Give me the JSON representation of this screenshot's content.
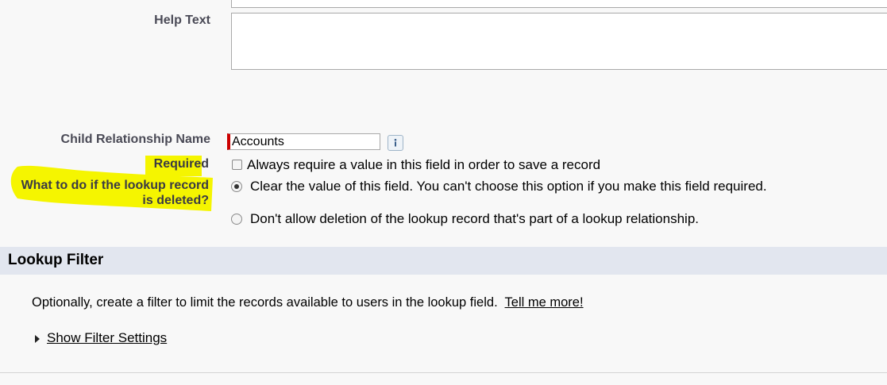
{
  "form": {
    "help_text_label": "Help Text",
    "help_text_value": "",
    "child_rel_label": "Child Relationship Name",
    "child_rel_value": "Accounts",
    "required_label": "Required",
    "required_checkbox_text": "Always require a value in this field in order to save a record",
    "required_checked": false,
    "delete_label_line1": "What to do if the lookup record",
    "delete_label_line2": "is deleted?",
    "delete_options": [
      {
        "label": "Clear the value of this field. You can't choose this option if you make this field required.",
        "selected": true
      },
      {
        "label": "Don't allow deletion of the lookup record that's part of a lookup relationship.",
        "selected": false
      }
    ]
  },
  "lookup_filter": {
    "title": "Lookup Filter",
    "description": "Optionally, create a filter to limit the records available to users in the lookup field.",
    "tell_me_more": "Tell me more!",
    "show_settings": "Show Filter Settings"
  },
  "colors": {
    "highlight": "#f5f500",
    "required_bar": "#cc0000",
    "section_bg": "#e2e6ef"
  },
  "icons": {
    "info": "info-icon",
    "expand": "triangle-right-icon"
  }
}
